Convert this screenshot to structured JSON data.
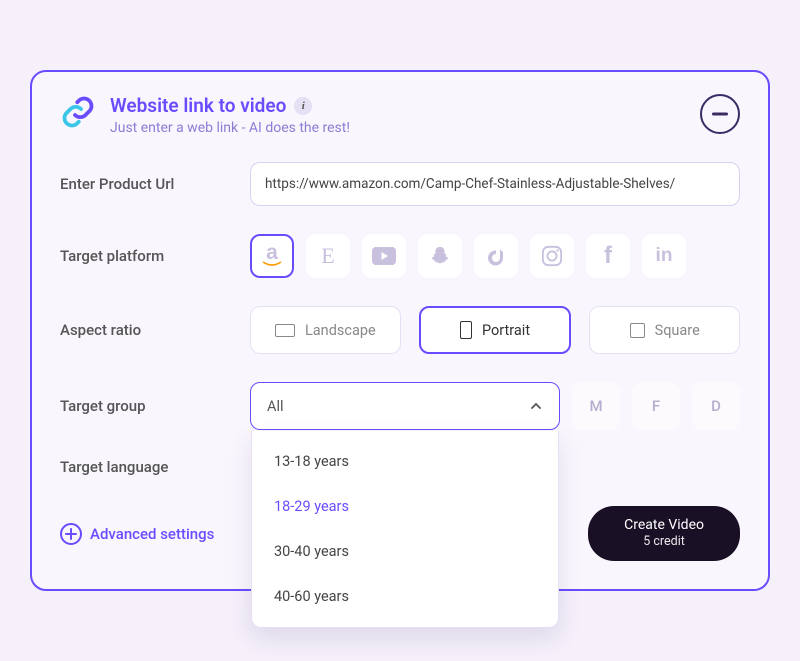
{
  "header": {
    "title": "Website link to video",
    "subtitle": "Just enter a web link - AI does the rest!",
    "info_glyph": "i"
  },
  "form": {
    "url_label": "Enter Product Url",
    "url_value": "https://www.amazon.com/Camp-Chef-Stainless-Adjustable-Shelves/",
    "platform_label": "Target platform",
    "platforms": [
      {
        "name": "amazon",
        "selected": true
      },
      {
        "name": "etsy",
        "selected": false
      },
      {
        "name": "youtube",
        "selected": false
      },
      {
        "name": "snapchat",
        "selected": false
      },
      {
        "name": "tiktok",
        "selected": false
      },
      {
        "name": "instagram",
        "selected": false
      },
      {
        "name": "facebook",
        "selected": false
      },
      {
        "name": "linkedin",
        "selected": false
      }
    ],
    "aspect_label": "Aspect ratio",
    "ratios": {
      "landscape": "Landscape",
      "portrait": "Portrait",
      "square": "Square",
      "selected": "portrait"
    },
    "group_label": "Target group",
    "group_selected": "All",
    "group_options": [
      "13-18 years",
      "18-29 years",
      "30-40 years",
      "40-60 years"
    ],
    "group_hovered_index": 1,
    "group_toggles": {
      "m": "M",
      "f": "F",
      "d": "D"
    },
    "lang_label": "Target language"
  },
  "footer": {
    "advanced_label": "Advanced settings",
    "create_label": "Create Video",
    "create_sub": "5 credit"
  }
}
